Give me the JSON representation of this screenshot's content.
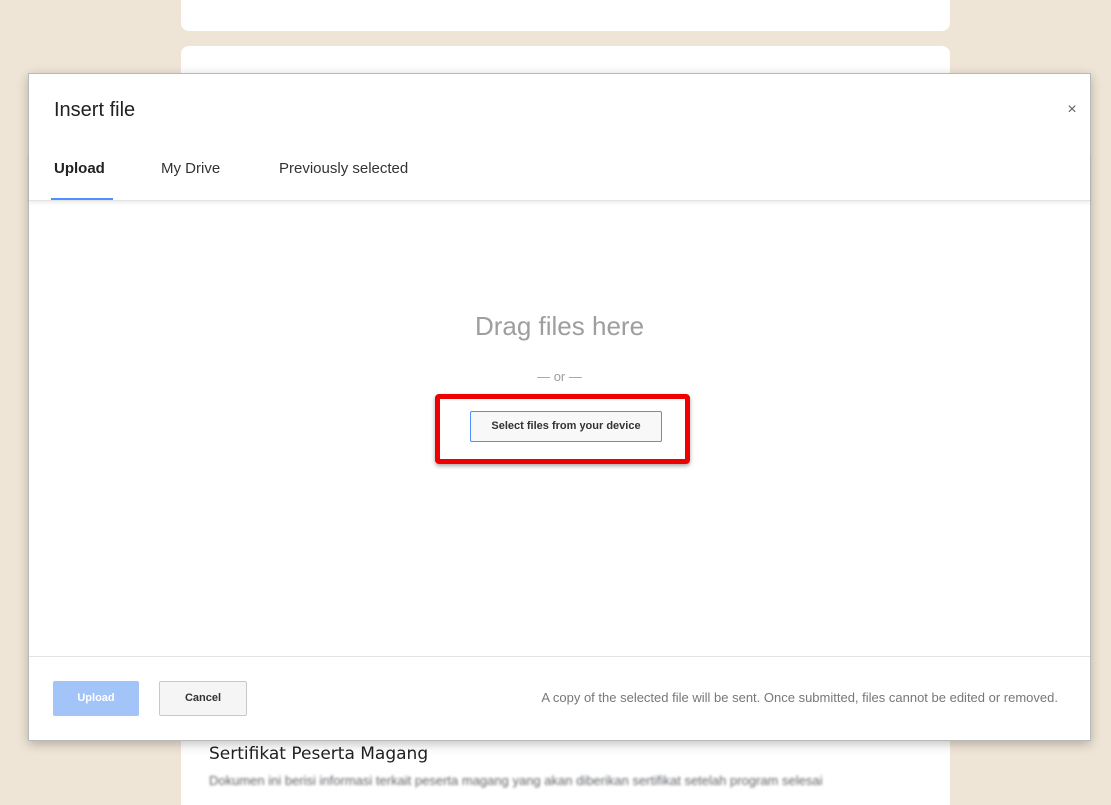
{
  "background": {
    "card_title": "Sertifikat Peserta Magang",
    "card_subtitle": "Dokumen ini berisi informasi terkait peserta magang yang akan diberikan sertifikat setelah program selesai"
  },
  "dialog": {
    "title": "Insert file",
    "close_icon": "close-icon",
    "close_glyph": "×",
    "tabs": [
      {
        "label": "Upload",
        "active": true
      },
      {
        "label": "My Drive",
        "active": false
      },
      {
        "label": "Previously selected",
        "active": false
      }
    ],
    "drop_area": {
      "heading": "Drag files here",
      "or_text": "— or —",
      "select_button": "Select files from your device"
    },
    "footer": {
      "upload_label": "Upload",
      "cancel_label": "Cancel",
      "note": "A copy of the selected file will be sent. Once submitted, files cannot be edited or removed."
    }
  },
  "colors": {
    "page_background": "#efe5d6",
    "accent": "#4d90fe",
    "upload_disabled": "#a3c4f8",
    "highlight": "#ee0000"
  }
}
